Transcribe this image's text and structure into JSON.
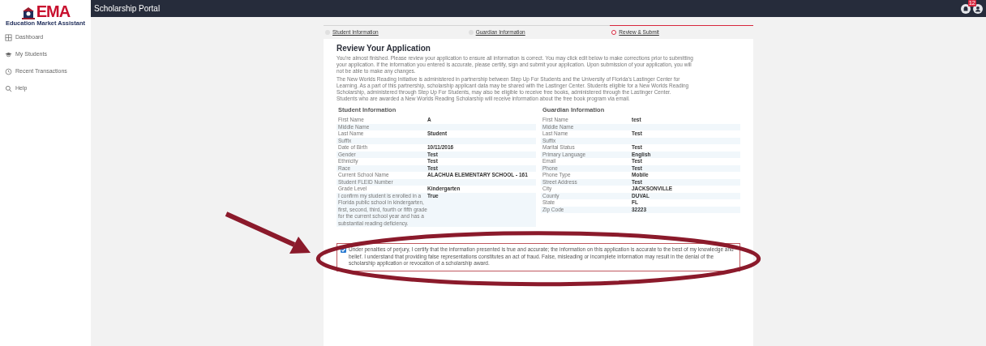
{
  "header": {
    "title": "Scholarship Portal",
    "notification_count": "12"
  },
  "sidebar": {
    "logo_text": "EMA",
    "logo_subtitle": "Education Market Assistant",
    "items": [
      {
        "label": "Dashboard"
      },
      {
        "label": "My Students"
      },
      {
        "label": "Recent Transactions"
      },
      {
        "label": "Help"
      }
    ]
  },
  "steps": [
    {
      "label": "Student Information",
      "selected": false
    },
    {
      "label": "Guardian Information",
      "selected": false
    },
    {
      "label": "Review & Submit",
      "selected": true
    }
  ],
  "review": {
    "title": "Review Your Application",
    "paragraphs": [
      "You're almost finished. Please review your application to ensure all information is correct. You may click edit below to make corrections prior to submitting your application. If the information you entered is accurate, please certify, sign and submit your application. Upon submission of your application, you will not be able to make any changes.",
      "The New Worlds Reading Initiative is administered in partnership between Step Up For Students and the University of Florida's Lastinger Center for Learning. As a part of this partnership, scholarship applicant data may be shared with the Lastinger Center. Students eligible for a New Worlds Reading Scholarship, administered through Step Up For Students, may also be eligible to receive free books, administered through the Lastinger Center. Students who are awarded a New Worlds Reading Scholarship will receive information about the free book program via email."
    ]
  },
  "sections": [
    {
      "title": "Student Information",
      "rows": [
        {
          "label": "First Name",
          "value": "A"
        },
        {
          "label": "Middle Name"
        },
        {
          "label": "Last Name",
          "value": "Student"
        },
        {
          "label": "Suffix"
        },
        {
          "label": "Date of Birth",
          "value": "10/11/2016"
        },
        {
          "label": "Gender",
          "value": "Test"
        },
        {
          "label": "Ethnicity",
          "value": "Test"
        },
        {
          "label": "Race",
          "value": "Test"
        },
        {
          "label": "Current School Name",
          "value": "ALACHUA ELEMENTARY SCHOOL - 161"
        },
        {
          "label": "Student FLEID Number"
        },
        {
          "label": "Grade Level",
          "value": "Kindergarten"
        },
        {
          "label": "I confirm my student is enrolled in a Florida public school in kindergarten, first, second, third, fourth or fifth grade for the current school year and has a substantial reading deficiency.",
          "value": "True"
        }
      ]
    },
    {
      "title": "Guardian Information",
      "rows": [
        {
          "label": "First Name",
          "value": "test"
        },
        {
          "label": "Middle Name"
        },
        {
          "label": "Last Name",
          "value": "Test"
        },
        {
          "label": "Suffix"
        },
        {
          "label": "Marital Status",
          "value": "Test"
        },
        {
          "label": "Primary Language",
          "value": "English"
        },
        {
          "label": "Email",
          "value": "Test"
        },
        {
          "label": "Phone",
          "value": "Test"
        },
        {
          "label": "Phone Type",
          "value": "Mobile"
        },
        {
          "label": "Street Address",
          "value": "Test"
        },
        {
          "label": "City",
          "value": "JACKSONVILLE"
        },
        {
          "label": "County",
          "value": "DUVAL"
        },
        {
          "label": "State",
          "value": "FL"
        },
        {
          "label": "Zip Code",
          "value": "32223"
        }
      ]
    }
  ],
  "certification": {
    "checked": true,
    "text": "Under penalties of perjury, I certify that the information presented is true and accurate; the information on this application is accurate to the best of my knowledge and belief. I understand that providing false representations constitutes an act of fraud. False, misleading or incomplete information may result in the denial of the scholarship application or revocation of a scholarship award."
  }
}
